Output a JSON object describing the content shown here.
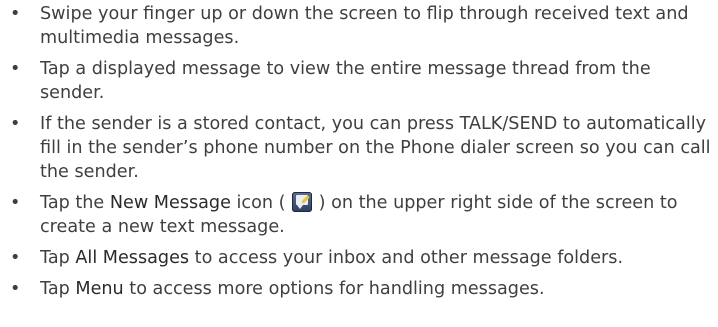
{
  "bullets": {
    "glyph": "•",
    "items": [
      {
        "text": "Swipe your finger up or down the screen to flip through received text and multimedia messages."
      },
      {
        "text": "Tap a displayed message to view the entire message thread from the sender."
      },
      {
        "text": "If the sender is a stored contact, you can press TALK/SEND to automatically fill in the sender’s phone number on the Phone dialer screen so you can call the sender."
      },
      {
        "before": "Tap the ",
        "term": "New Message",
        "middle": " icon (",
        "icon": "new-message-icon",
        "after": ") on the upper right side of the screen to create a new text message."
      },
      {
        "before": "Tap ",
        "term": "All Messages",
        "after": " to access your inbox and other message folders."
      },
      {
        "before": " Tap ",
        "term": "Menu",
        "after": " to access more options for handling messages."
      }
    ]
  }
}
